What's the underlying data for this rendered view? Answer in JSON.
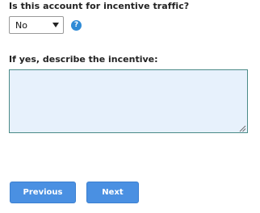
{
  "form": {
    "incentive_question": "Is this account for incentive traffic?",
    "incentive_select": {
      "selected": "No",
      "options": [
        "No"
      ]
    },
    "help_icon": "question-circle-icon",
    "help_glyph": "?",
    "description_label": "If yes, describe the incentive:",
    "description_value": ""
  },
  "buttons": {
    "previous_label": "Previous",
    "next_label": "Next"
  },
  "colors": {
    "button_blue": "#4a90e2",
    "help_icon_blue": "#2f8bd6",
    "textarea_bg": "#e7f1fc",
    "textarea_border": "#4a8a88"
  }
}
